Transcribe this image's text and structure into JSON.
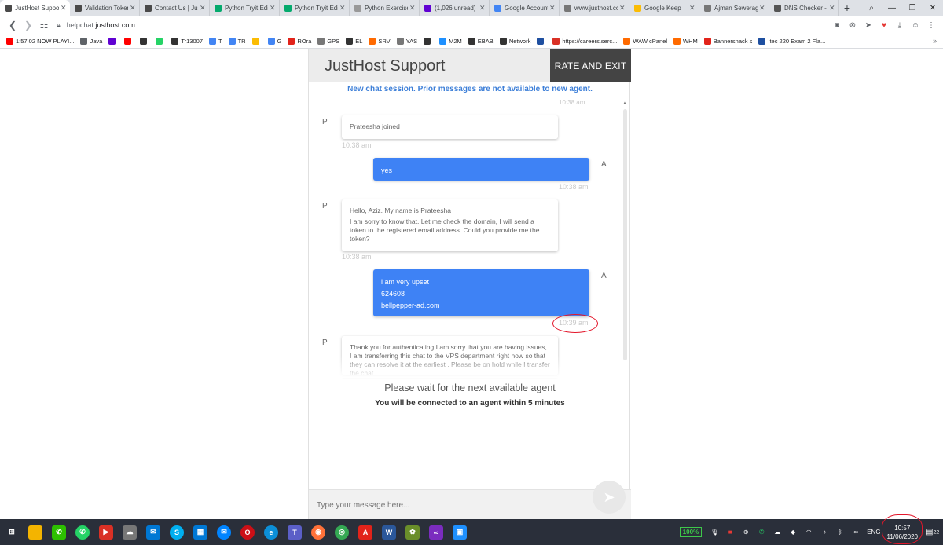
{
  "tabs": [
    {
      "title": "JustHost Support",
      "icon": "justhost-favicon",
      "color": "#4a4a4a",
      "active": true
    },
    {
      "title": "Validation Token",
      "icon": "justhost-favicon",
      "color": "#4a4a4a"
    },
    {
      "title": "Contact Us | JustHost",
      "icon": "justhost-favicon",
      "color": "#4a4a4a"
    },
    {
      "title": "Python Tryit Editor",
      "icon": "w3-favicon",
      "color": "#04aa6d"
    },
    {
      "title": "Python Tryit Editor",
      "icon": "w3-favicon",
      "color": "#04aa6d"
    },
    {
      "title": "Python Exercises",
      "icon": "w3r-favicon",
      "color": "#999999"
    },
    {
      "title": "(1,026 unread)",
      "icon": "mail-favicon",
      "color": "#6001d2"
    },
    {
      "title": "Google Account",
      "icon": "google-favicon",
      "color": "#4285f4"
    },
    {
      "title": "www.justhost.com",
      "icon": "page-favicon",
      "color": "#777777"
    },
    {
      "title": "Google Keep",
      "icon": "keep-favicon",
      "color": "#fbbc04"
    },
    {
      "title": "Ajman Sewerage",
      "icon": "page-favicon",
      "color": "#777777"
    },
    {
      "title": "DNS Checker -",
      "icon": "globe-favicon",
      "color": "#555555"
    }
  ],
  "toolbar": {
    "url_host": "helpchat.",
    "url_rest": "justhost.com"
  },
  "bookmarks": [
    {
      "label": "1:57:02 NOW PLAYI...",
      "color": "#ff0000"
    },
    {
      "label": "Java",
      "color": "#5f6368"
    },
    {
      "label": "",
      "color": "#6001d2"
    },
    {
      "label": "",
      "color": "#ff0000"
    },
    {
      "label": "",
      "color": "#333333"
    },
    {
      "label": "",
      "color": "#25d366"
    },
    {
      "label": "Tr13007",
      "color": "#333333"
    },
    {
      "label": "T",
      "color": "#4285f4"
    },
    {
      "label": "TR",
      "color": "#4285f4"
    },
    {
      "label": "",
      "color": "#fbbc04"
    },
    {
      "label": "G",
      "color": "#4285f4"
    },
    {
      "label": "ROra",
      "color": "#e2231a"
    },
    {
      "label": "GPS",
      "color": "#777777"
    },
    {
      "label": "EL",
      "color": "#333333"
    },
    {
      "label": "SRV",
      "color": "#ff6a00"
    },
    {
      "label": "YAS",
      "color": "#777777"
    },
    {
      "label": "",
      "color": "#333333"
    },
    {
      "label": "M2M",
      "color": "#1e90ff"
    },
    {
      "label": "EBAB",
      "color": "#333333"
    },
    {
      "label": "Network",
      "color": "#333333"
    },
    {
      "label": "",
      "color": "#1e4fa0"
    },
    {
      "label": "https://careers.serc...",
      "color": "#d93025"
    },
    {
      "label": "WAW cPanel",
      "color": "#ff6a00"
    },
    {
      "label": "WHM",
      "color": "#ff6a00"
    },
    {
      "label": "Bannersnack s",
      "color": "#e2231a"
    },
    {
      "label": "Itec 220 Exam 2 Fla...",
      "color": "#1e4fa0"
    }
  ],
  "chat": {
    "title": "JustHost Support",
    "rate_exit": "RATE AND EXIT",
    "notice": "New chat session. Prior messages are not available to new agent.",
    "scroll_ts": "10:38 am",
    "messages": [
      {
        "from": "P",
        "side": "in",
        "lines": [
          "Prateesha joined"
        ],
        "time": "10:38 am"
      },
      {
        "from": "A",
        "side": "out",
        "lines": [
          "yes"
        ],
        "time": "10:38 am"
      },
      {
        "from": "P",
        "side": "in",
        "lines": [
          "Hello, Aziz. My name is Prateesha",
          "I am sorry to know that. Let me check the domain, I will send a token to the registered email address. Could you provide me the token?"
        ],
        "time": "10:38 am"
      },
      {
        "from": "A",
        "side": "out",
        "lines": [
          "i am very upset",
          "624608",
          "bellpepper-ad.com"
        ],
        "time": "10:39 am"
      },
      {
        "from": "P",
        "side": "in",
        "lines": [
          "Thank you for authenticating.I am sorry that you are having issues, I am transferring this chat to the VPS department right now so that they can resolve it at the earliest . Please be on hold while I transfer the chat."
        ],
        "time": ""
      }
    ],
    "wait_title": "Please wait for the next available agent",
    "wait_sub": "You will be connected to an agent within 5 minutes",
    "input_placeholder": "Type your message here..."
  },
  "taskbar": {
    "battery": "100%",
    "lang": "ENG",
    "time": "10:57",
    "date": "11/06/2020",
    "notif_count": "22"
  },
  "colors": {
    "accent": "#3e82f5",
    "notice": "#3d7fd8",
    "header_btn": "#444444",
    "annotation": "#e3172b"
  }
}
